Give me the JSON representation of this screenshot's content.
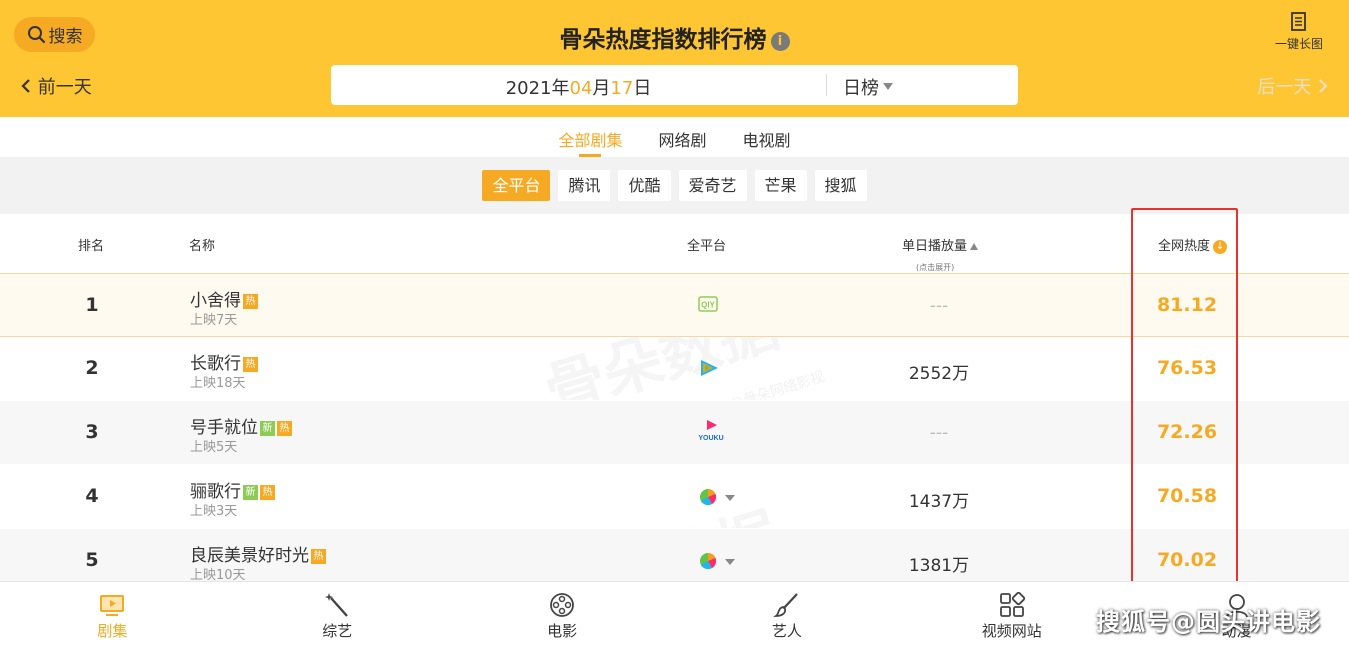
{
  "header": {
    "search_label": "搜索",
    "title": "骨朵热度指数排行榜",
    "long_pic_label": "一键长图",
    "prev_day": "前一天",
    "next_day": "后一天",
    "date_year": "2021",
    "date_year_unit": "年",
    "date_month": "04",
    "date_month_unit": "月",
    "date_day": "17",
    "date_day_unit": "日",
    "period": "日榜"
  },
  "category_tabs": [
    {
      "label": "全部剧集",
      "active": true
    },
    {
      "label": "网络剧",
      "active": false
    },
    {
      "label": "电视剧",
      "active": false
    }
  ],
  "platforms": [
    {
      "label": "全平台",
      "active": true
    },
    {
      "label": "腾讯",
      "active": false
    },
    {
      "label": "优酷",
      "active": false
    },
    {
      "label": "爱奇艺",
      "active": false
    },
    {
      "label": "芒果",
      "active": false
    },
    {
      "label": "搜狐",
      "active": false
    }
  ],
  "table": {
    "col_rank": "排名",
    "col_name": "名称",
    "col_platform": "全平台",
    "col_plays": "单日播放量",
    "col_plays_hint": "(点击展开)",
    "col_heat": "全网热度",
    "rows": [
      {
        "rank": "1",
        "name": "小舍得",
        "badges": [
          "热"
        ],
        "release": "上映7天",
        "platform": "iqiyi",
        "plays": "---",
        "heat": "81.12"
      },
      {
        "rank": "2",
        "name": "长歌行",
        "badges": [
          "热"
        ],
        "release": "上映18天",
        "platform": "tencent",
        "plays": "2552万",
        "heat": "76.53"
      },
      {
        "rank": "3",
        "name": "号手就位",
        "badges": [
          "新",
          "热"
        ],
        "release": "上映5天",
        "platform": "youku",
        "plays": "---",
        "heat": "72.26"
      },
      {
        "rank": "4",
        "name": "骊歌行",
        "badges": [
          "新",
          "热"
        ],
        "release": "上映3天",
        "platform": "multi",
        "plays": "1437万",
        "heat": "70.58"
      },
      {
        "rank": "5",
        "name": "良辰美景好时光",
        "badges": [
          "热"
        ],
        "release": "上映10天",
        "platform": "multi",
        "plays": "1381万",
        "heat": "70.02"
      }
    ]
  },
  "watermark": {
    "main": "骨朵数据",
    "sub": "@骨朵网络影视"
  },
  "bottom_nav": [
    {
      "label": "剧集",
      "icon": "tv-icon",
      "active": true
    },
    {
      "label": "综艺",
      "icon": "magic-wand-icon",
      "active": false
    },
    {
      "label": "电影",
      "icon": "film-reel-icon",
      "active": false
    },
    {
      "label": "艺人",
      "icon": "brush-icon",
      "active": false
    },
    {
      "label": "视频网站",
      "icon": "apps-icon",
      "active": false
    },
    {
      "label": "动漫",
      "icon": "character-icon",
      "active": false
    }
  ],
  "credit": "搜狐号@圆头讲电影",
  "colors": {
    "accent": "#f6aa23",
    "header_bg": "#fdc632",
    "highlight_box": "#e8332c"
  }
}
